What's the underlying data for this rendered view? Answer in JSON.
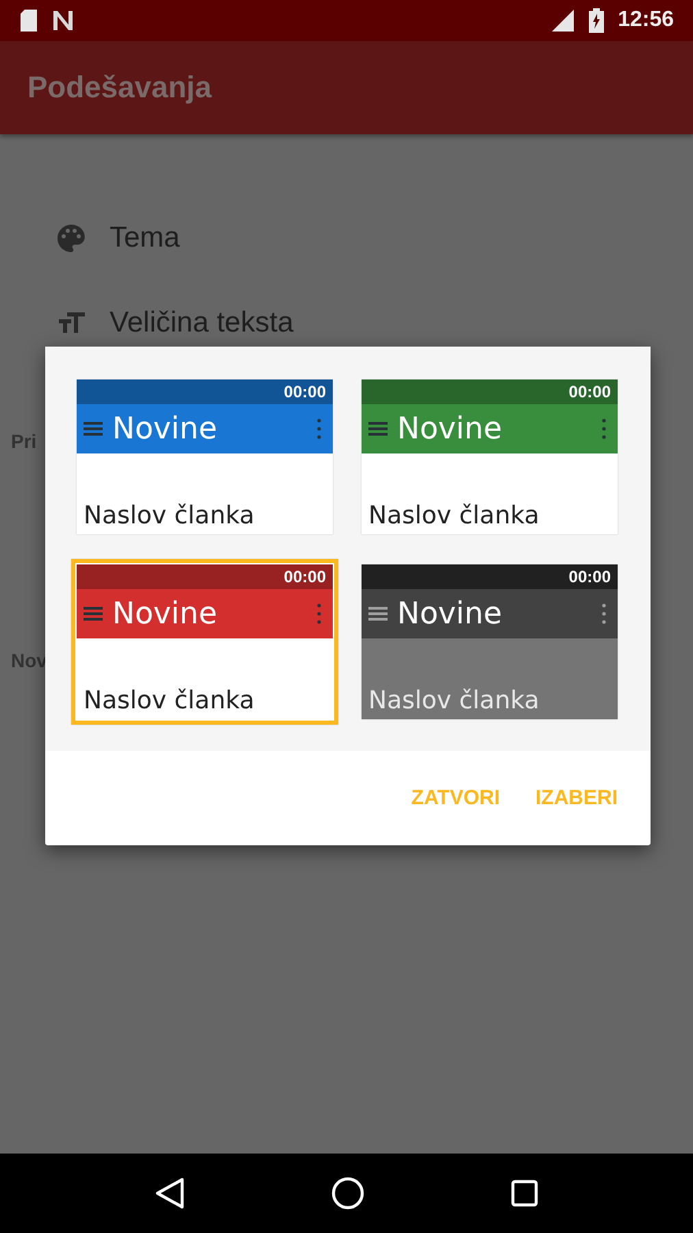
{
  "status_bar": {
    "time": "12:56"
  },
  "app_bar": {
    "title": "Podešavanja"
  },
  "settings": [
    {
      "kind": "palette",
      "label": "Tema"
    },
    {
      "kind": "text-size",
      "label": "Veličina teksta"
    }
  ],
  "sections": [
    {
      "label": "Pri"
    },
    {
      "label": "Nov"
    }
  ],
  "dialog": {
    "themes": [
      {
        "clock": "00:00",
        "title": "Novine",
        "article": "Naslov članka",
        "color": "#1976d2",
        "kind": "light",
        "selected": false
      },
      {
        "clock": "00:00",
        "title": "Novine",
        "article": "Naslov članka",
        "color": "#388e3c",
        "kind": "light",
        "selected": false
      },
      {
        "clock": "00:00",
        "title": "Novine",
        "article": "Naslov članka",
        "color": "#d32f2f",
        "kind": "light",
        "selected": true
      },
      {
        "clock": "00:00",
        "title": "Novine",
        "article": "Naslov članka",
        "color": "#424242",
        "kind": "dark",
        "selected": false
      }
    ],
    "buttons": [
      "ZATVORI",
      "IZABERI"
    ]
  }
}
